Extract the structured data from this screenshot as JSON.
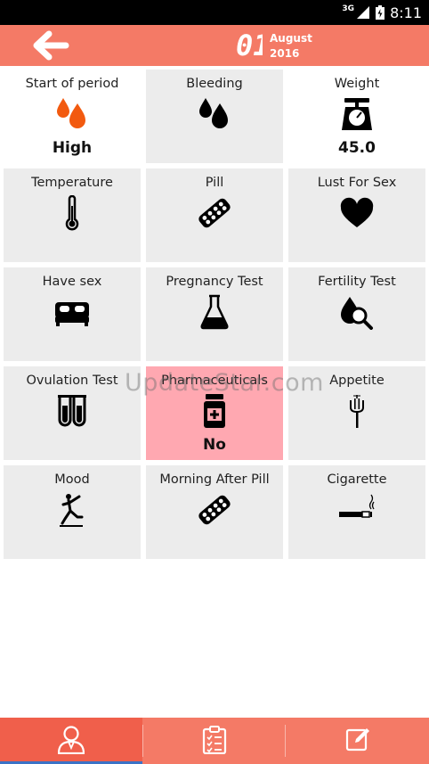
{
  "status_bar": {
    "network": "3G",
    "time": "8:11"
  },
  "header": {
    "day": "01",
    "month": "August",
    "year": "2016"
  },
  "grid": [
    {
      "label": "Start of period",
      "value": "High",
      "icon": "drops-icon"
    },
    {
      "label": "Bleeding",
      "value": "",
      "icon": "drops-icon"
    },
    {
      "label": "Weight",
      "value": "45.0",
      "icon": "scale-icon"
    },
    {
      "label": "Temperature",
      "value": "",
      "icon": "thermometer-icon"
    },
    {
      "label": "Pill",
      "value": "",
      "icon": "pill-pack-icon"
    },
    {
      "label": "Lust For Sex",
      "value": "",
      "icon": "heart-icon"
    },
    {
      "label": "Have sex",
      "value": "",
      "icon": "bed-icon"
    },
    {
      "label": "Pregnancy Test",
      "value": "",
      "icon": "flask-icon"
    },
    {
      "label": "Fertility Test",
      "value": "",
      "icon": "magnifier-drop-icon"
    },
    {
      "label": "Ovulation Test",
      "value": "",
      "icon": "test-tubes-icon"
    },
    {
      "label": "Pharmaceuticals",
      "value": "No",
      "icon": "medicine-bottle-icon"
    },
    {
      "label": "Appetite",
      "value": "",
      "icon": "fork-icon"
    },
    {
      "label": "Mood",
      "value": "",
      "icon": "dancer-icon"
    },
    {
      "label": "Morning After Pill",
      "value": "",
      "icon": "pill-pack-icon"
    },
    {
      "label": "Cigarette",
      "value": "",
      "icon": "cigarette-icon"
    }
  ],
  "watermark": "UpdateStar.com",
  "colors": {
    "accent": "#f47a66",
    "active_tab": "#f05f4b",
    "highlight_cell": "#ffa8b1",
    "drop_orange": "#f25a0f",
    "tab_indicator": "#3b73c7"
  },
  "bottom_nav": [
    {
      "icon": "user-icon",
      "active": true
    },
    {
      "icon": "clipboard-icon",
      "active": false
    },
    {
      "icon": "edit-icon",
      "active": false
    }
  ]
}
